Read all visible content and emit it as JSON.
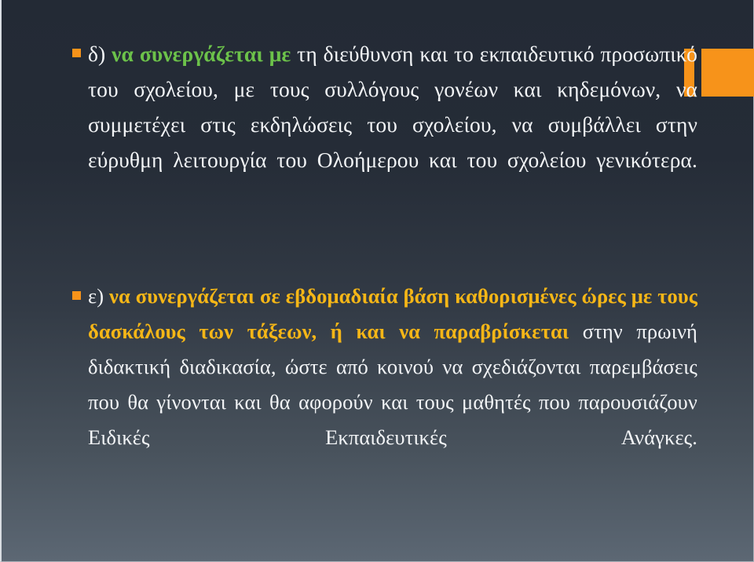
{
  "slide": {
    "background_top_color": "#232a35",
    "background_bottom_color": "#5d6874",
    "accent_color": "#F7931A",
    "highlight_green": "#6CC24A",
    "highlight_gold": "#F5B617",
    "text_color": "#f2f4f6"
  },
  "decoration": {
    "name": "orange-corner-accent",
    "bar_color": "#F7931A",
    "block_color": "#F7931A"
  },
  "bullets": [
    {
      "marker": "square",
      "label": "δ)",
      "segments": [
        {
          "text": "δ) ",
          "style": "plain"
        },
        {
          "text": "να συνεργάζεται με ",
          "style": "green"
        },
        {
          "text": "τη διεύθυνση και το εκπαιδευτικό προσωπικό του σχολείου, με τους συλλόγους γονέων και κηδεμόνων, να συμμετέχει στις εκδηλώσεις του σχολείου, να συμβάλλει στην εύρυθμη λειτουργία του Ολοήμερου και του σχολείου γενικότερα.",
          "style": "plain"
        }
      ],
      "full_text": "δ) να συνεργάζεται με τη διεύθυνση και το εκπαιδευτικό προσωπικό του σχολείου, με τους συλλόγους γονέων και κηδεμόνων, να συμμετέχει στις εκδηλώσεις του σχολείου, να συμβάλλει στην εύρυθμη λειτουργία του Ολοήμερου και του σχολείου γενικότερα."
    },
    {
      "marker": "square",
      "label": "ε)",
      "segments": [
        {
          "text": "ε) ",
          "style": "plain"
        },
        {
          "text": "να συνεργάζεται σε εβδομαδιαία βάση καθορισμένες ώρες με τους δασκάλους των τάξεων, ή και να παραβρίσκεται ",
          "style": "gold"
        },
        {
          "text": "στην πρωινή διδακτική διαδικασία, ώστε από κοινού να σχεδιάζονται παρεμβάσεις που θα γίνονται και θα αφορούν και τους μαθητές που παρουσιάζουν Ειδικές Εκπαιδευτικές Ανάγκες.",
          "style": "plain"
        }
      ],
      "full_text": "ε) να συνεργάζεται σε εβδομαδιαία βάση καθορισμένες ώρες με τους δασκάλους των τάξεων, ή και να παραβρίσκεται στην πρωινή διδακτική διαδικασία, ώστε από κοινού να σχεδιάζονται παρεμβάσεις που θα γίνονται και θα αφορούν και τους μαθητές που παρουσιάζουν Ειδικές Εκπαιδευτικές Ανάγκες."
    }
  ]
}
